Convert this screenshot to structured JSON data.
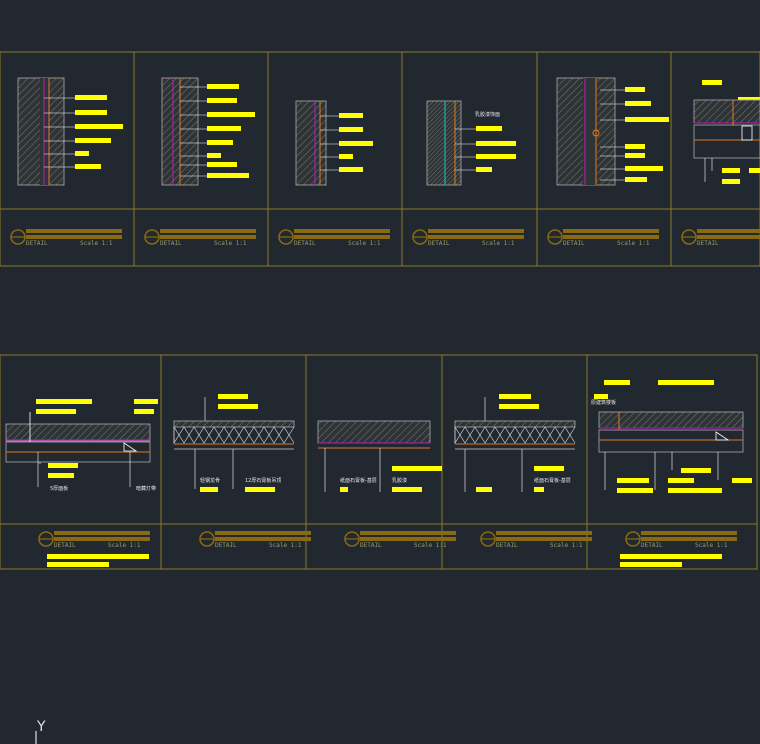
{
  "colors": {
    "background": "#212830",
    "frame": "#8a7a2a",
    "label_bar": "#ffff00",
    "hatch": "#8a8a8a",
    "hatch_fill": "#3a3a3a",
    "magenta": "#c018c0",
    "orange": "#e07820",
    "teal": "#1aa090",
    "white": "#ffffff",
    "title_bar": "#8a6a10"
  },
  "row1": {
    "panels": [
      {
        "detail": "DETAIL",
        "scale": "Scale 1:1",
        "notes": []
      },
      {
        "detail": "DETAIL",
        "scale": "Scale 1:1",
        "notes": []
      },
      {
        "detail": "DETAIL",
        "scale": "Scale 1:1",
        "notes": []
      },
      {
        "detail": "DETAIL",
        "scale": "Scale 1:1",
        "notes": [
          "乳胶漆饰面"
        ]
      },
      {
        "detail": "DETAIL",
        "scale": "Scale 1:1",
        "notes": []
      },
      {
        "detail": "DETAIL",
        "scale": "",
        "notes": []
      }
    ]
  },
  "row2": {
    "panels": [
      {
        "detail": "DETAIL",
        "scale": "Scale 1:1",
        "notes": [
          "5厚面板",
          "暗藏灯带"
        ]
      },
      {
        "detail": "DETAIL",
        "scale": "Scale 1:1",
        "notes": [
          "轻钢龙骨",
          "12厚石膏板吊顶"
        ]
      },
      {
        "detail": "DETAIL",
        "scale": "Scale 1:1",
        "notes": [
          "纸面石膏板-基层",
          "乳胶漆"
        ]
      },
      {
        "detail": "DETAIL",
        "scale": "Scale 1:1",
        "notes": [
          "纸面石膏板-基层"
        ]
      },
      {
        "detail": "DETAIL",
        "scale": "Scale 1:1",
        "notes": [
          "原建筑楼板"
        ]
      }
    ]
  },
  "ucs": {
    "axis_label": "Y"
  }
}
